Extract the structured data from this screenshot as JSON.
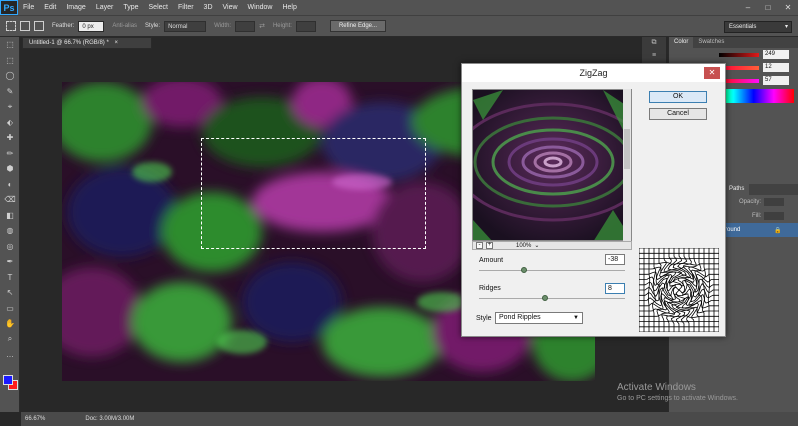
{
  "app": {
    "logo": "Ps"
  },
  "menu": [
    "File",
    "Edit",
    "Image",
    "Layer",
    "Type",
    "Select",
    "Filter",
    "3D",
    "View",
    "Window",
    "Help"
  ],
  "window_controls": [
    "–",
    "□",
    "✕"
  ],
  "options": {
    "feather_label": "Feather:",
    "feather_value": "0 px",
    "antialias_label": "Anti-alias",
    "style_label": "Style:",
    "style_value": "Normal",
    "width_label": "Width:",
    "height_label": "Height:",
    "refine_edge": "Refine Edge...",
    "workspace": "Essentials"
  },
  "document": {
    "tab_title": "Untitled-1 @ 66.7% (RGB/8) *",
    "tab_close": "×"
  },
  "status": {
    "zoom": "66.67%",
    "doc": "Doc: 3.00M/3.00M"
  },
  "panels": {
    "color_tabs": [
      "Color",
      "Swatches"
    ],
    "rgb": [
      {
        "channel": "R",
        "value": "249",
        "color": "#e01a1a"
      },
      {
        "channel": "G",
        "value": "12",
        "color": "#2a8a2a"
      },
      {
        "channel": "B",
        "value": "57",
        "color": "#2a2aff"
      }
    ],
    "layers_tabs": [
      "Paths"
    ],
    "opacity_label": "Opacity:",
    "fill_label": "Fill:",
    "layer_name": "round"
  },
  "dialog": {
    "title": "ZigZag",
    "close": "✕",
    "ok": "OK",
    "cancel": "Cancel",
    "zoom": "100%",
    "zoom_minus": "-",
    "zoom_plus": "+",
    "amount_label": "Amount",
    "amount_value": "-38",
    "amount_pos": 0.31,
    "ridges_label": "Ridges",
    "ridges_value": "8",
    "ridges_pos": 0.45,
    "style_label": "Style",
    "style_value": "Pond Ripples"
  },
  "watermark": {
    "title": "Activate Windows",
    "subtitle": "Go to PC settings to activate Windows."
  },
  "tools": [
    "⬚",
    "⬚",
    "◯",
    "✎",
    "⌖",
    "⬖",
    "✚",
    "✏",
    "⬢",
    "◐",
    "⌫",
    "◧",
    "◍",
    "◎",
    "✒",
    "T",
    "↖",
    "▭",
    "✋",
    "⌕",
    "…"
  ]
}
